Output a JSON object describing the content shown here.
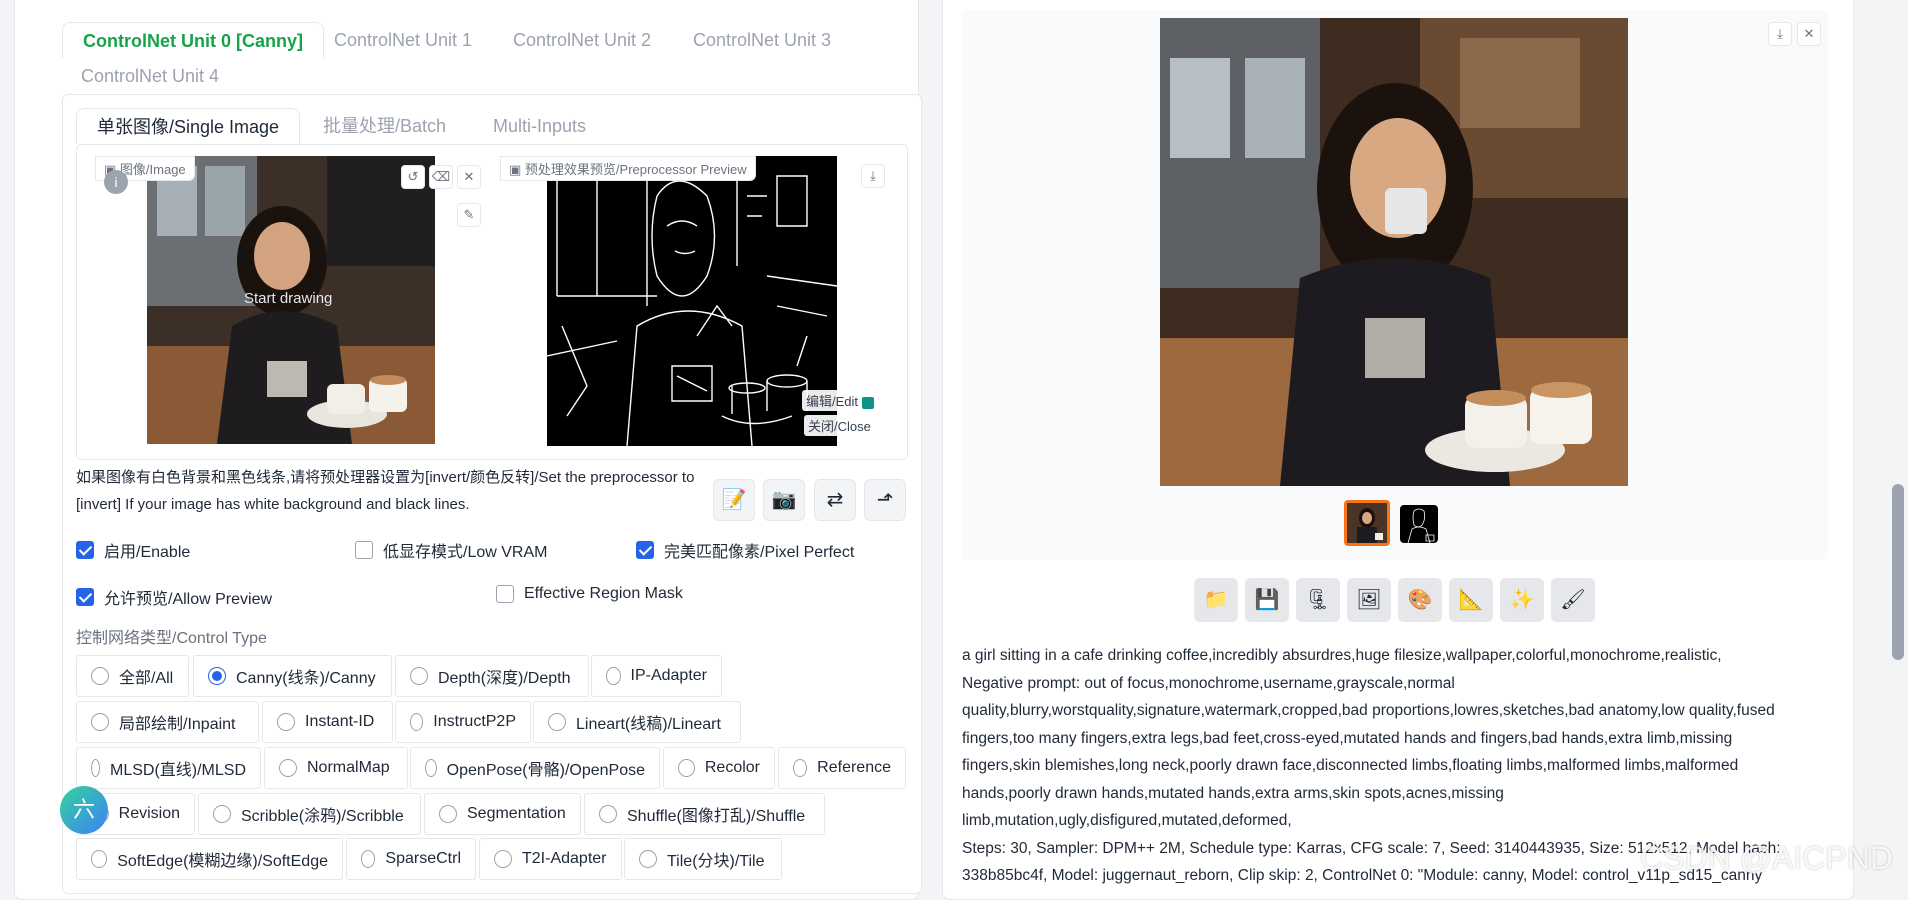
{
  "controlnet": {
    "unit_tabs": [
      "ControlNet Unit 0 [Canny]",
      "ControlNet Unit 1",
      "ControlNet Unit 2",
      "ControlNet Unit 3",
      "ControlNet Unit 4"
    ],
    "image_tabs": [
      "单张图像/Single Image",
      "批量处理/Batch",
      "Multi-Inputs"
    ],
    "image_label": "图像/Image",
    "preview_label": "预处理效果预览/Preprocessor Preview",
    "start_drawing": "Start drawing",
    "edit_label": "编辑/Edit",
    "close_label": "关闭/Close",
    "notice": "如果图像有白色背景和黑色线条,请将预处理器设置为[invert/颜色反转]/Set the preprocessor to [invert] If your image has white background and black lines.",
    "checkboxes": {
      "enable": "启用/Enable",
      "low_vram": "低显存模式/Low VRAM",
      "pixel_perfect": "完美匹配像素/Pixel Perfect",
      "allow_preview": "允许预览/Allow Preview",
      "effective_region_mask": "Effective Region Mask"
    },
    "control_type_label": "控制网络类型/Control Type",
    "control_types": [
      "全部/All",
      "Canny(线条)/Canny",
      "Depth(深度)/Depth",
      "IP-Adapter",
      "局部绘制/Inpaint",
      "Instant-ID",
      "InstructP2P",
      "Lineart(线稿)/Lineart",
      "MLSD(直线)/MLSD",
      "NormalMap",
      "OpenPose(骨骼)/OpenPose",
      "Recolor",
      "Reference",
      "Revision",
      "Scribble(涂鸦)/Scribble",
      "Segmentation",
      "Shuffle(图像打乱)/Shuffle",
      "SoftEdge(模糊边缘)/SoftEdge",
      "SparseCtrl",
      "T2I-Adapter",
      "Tile(分块)/Tile"
    ],
    "selected_control_type": "Canny(线条)/Canny",
    "avatar_char": "六"
  },
  "output": {
    "info_lines": [
      "a girl sitting in a cafe drinking coffee,incredibly absurdres,huge filesize,wallpaper,colorful,monochrome,realistic,",
      "Negative prompt: out of focus,monochrome,username,grayscale,normal",
      "quality,blurry,worstquality,signature,watermark,cropped,bad proportions,lowres,sketches,bad anatomy,low quality,fused",
      "fingers,too many fingers,extra legs,bad feet,cross-eyed,mutated hands and fingers,bad hands,extra limb,missing",
      "fingers,skin blemishes,long neck,poorly drawn face,disconnected limbs,floating limbs,malformed limbs,malformed",
      "hands,poorly drawn hands,mutated hands,extra arms,skin spots,acnes,missing",
      "limb,mutation,ugly,disfigured,mutated,deformed,",
      "Steps: 30, Sampler: DPM++ 2M, Schedule type: Karras, CFG scale: 7, Seed: 3140443935, Size: 512x512, Model hash:",
      "338b85bc4f, Model: juggernaut_reborn, Clip skip: 2, ControlNet 0: \"Module: canny, Model: control_v11p_sd15_canny"
    ],
    "watermark": "CSDN @AICPND"
  },
  "icons": {
    "folder": "📁",
    "save": "💾",
    "zip": "🗜",
    "image": "🖼",
    "palette": "🎨",
    "ruler": "📐",
    "sparkle": "✨",
    "brush": "🖌",
    "edit_pencil": "📝",
    "camera": "📷",
    "swap": "⇄",
    "send": "⬏",
    "reset": "↺",
    "eraser": "⌫",
    "close": "✕",
    "download": "⤓",
    "pen": "✎"
  }
}
